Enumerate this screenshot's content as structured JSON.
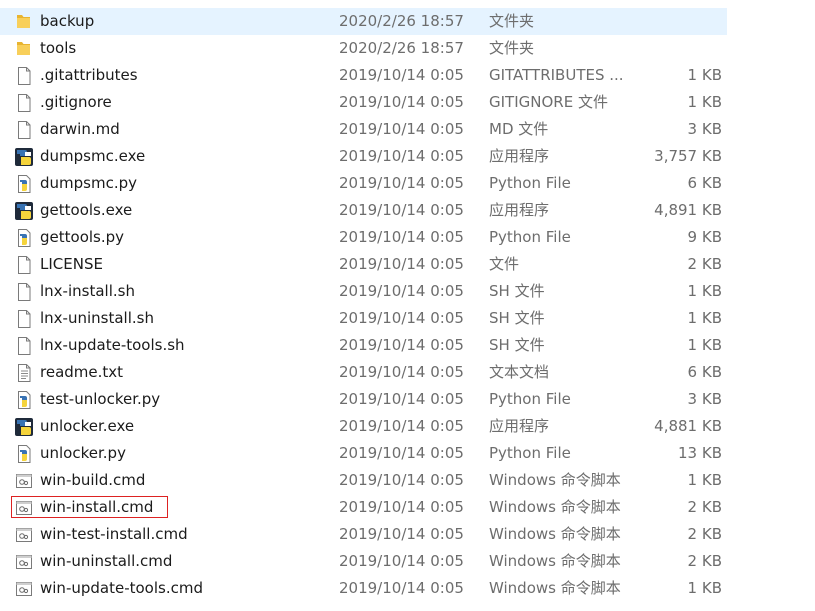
{
  "files": [
    {
      "name": "backup",
      "date": "2020/2/26 18:57",
      "type": "文件夹",
      "size": "",
      "icon": "folder-icon",
      "selected": true
    },
    {
      "name": "tools",
      "date": "2020/2/26 18:57",
      "type": "文件夹",
      "size": "",
      "icon": "folder-icon"
    },
    {
      "name": ".gitattributes",
      "date": "2019/10/14 0:05",
      "type": "GITATTRIBUTES ...",
      "size": "1 KB",
      "icon": "document-icon"
    },
    {
      "name": ".gitignore",
      "date": "2019/10/14 0:05",
      "type": "GITIGNORE 文件",
      "size": "1 KB",
      "icon": "document-icon"
    },
    {
      "name": "darwin.md",
      "date": "2019/10/14 0:05",
      "type": "MD 文件",
      "size": "3 KB",
      "icon": "document-icon"
    },
    {
      "name": "dumpsmc.exe",
      "date": "2019/10/14 0:05",
      "type": "应用程序",
      "size": "3,757 KB",
      "icon": "python-exe-icon"
    },
    {
      "name": "dumpsmc.py",
      "date": "2019/10/14 0:05",
      "type": "Python File",
      "size": "6 KB",
      "icon": "python-file-icon"
    },
    {
      "name": "gettools.exe",
      "date": "2019/10/14 0:05",
      "type": "应用程序",
      "size": "4,891 KB",
      "icon": "python-exe-icon"
    },
    {
      "name": "gettools.py",
      "date": "2019/10/14 0:05",
      "type": "Python File",
      "size": "9 KB",
      "icon": "python-file-icon"
    },
    {
      "name": "LICENSE",
      "date": "2019/10/14 0:05",
      "type": "文件",
      "size": "2 KB",
      "icon": "document-icon"
    },
    {
      "name": "lnx-install.sh",
      "date": "2019/10/14 0:05",
      "type": "SH 文件",
      "size": "1 KB",
      "icon": "document-icon"
    },
    {
      "name": "lnx-uninstall.sh",
      "date": "2019/10/14 0:05",
      "type": "SH 文件",
      "size": "1 KB",
      "icon": "document-icon"
    },
    {
      "name": "lnx-update-tools.sh",
      "date": "2019/10/14 0:05",
      "type": "SH 文件",
      "size": "1 KB",
      "icon": "document-icon"
    },
    {
      "name": "readme.txt",
      "date": "2019/10/14 0:05",
      "type": "文本文档",
      "size": "6 KB",
      "icon": "text-document-icon"
    },
    {
      "name": "test-unlocker.py",
      "date": "2019/10/14 0:05",
      "type": "Python File",
      "size": "3 KB",
      "icon": "python-file-icon"
    },
    {
      "name": "unlocker.exe",
      "date": "2019/10/14 0:05",
      "type": "应用程序",
      "size": "4,881 KB",
      "icon": "python-exe-icon"
    },
    {
      "name": "unlocker.py",
      "date": "2019/10/14 0:05",
      "type": "Python File",
      "size": "13 KB",
      "icon": "python-file-icon"
    },
    {
      "name": "win-build.cmd",
      "date": "2019/10/14 0:05",
      "type": "Windows 命令脚本",
      "size": "1 KB",
      "icon": "cmd-script-icon"
    },
    {
      "name": "win-install.cmd",
      "date": "2019/10/14 0:05",
      "type": "Windows 命令脚本",
      "size": "2 KB",
      "icon": "cmd-script-icon",
      "highlighted": true
    },
    {
      "name": "win-test-install.cmd",
      "date": "2019/10/14 0:05",
      "type": "Windows 命令脚本",
      "size": "2 KB",
      "icon": "cmd-script-icon"
    },
    {
      "name": "win-uninstall.cmd",
      "date": "2019/10/14 0:05",
      "type": "Windows 命令脚本",
      "size": "2 KB",
      "icon": "cmd-script-icon"
    },
    {
      "name": "win-update-tools.cmd",
      "date": "2019/10/14 0:05",
      "type": "Windows 命令脚本",
      "size": "1 KB",
      "icon": "cmd-script-icon"
    }
  ],
  "colors": {
    "selection": "#e5f3ff",
    "highlight_box": "#dd2222",
    "folder": "#f5c342",
    "python_blue": "#3873b4",
    "python_yellow": "#f5d43c"
  }
}
